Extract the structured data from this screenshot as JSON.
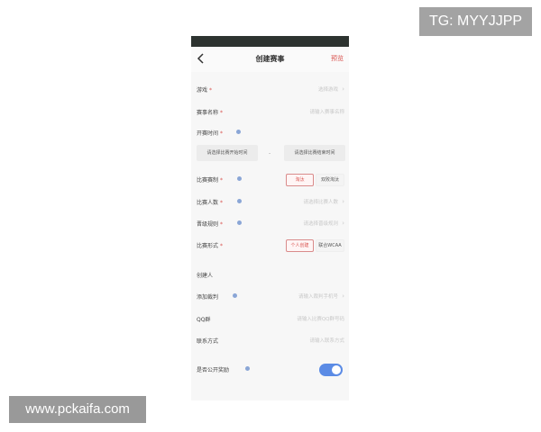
{
  "watermarks": {
    "tg": "TG: MYYJJPP",
    "site": "www.pckaifa.com"
  },
  "nav": {
    "back_icon": "chevron-left-icon",
    "title": "创建赛事",
    "preview": "预览"
  },
  "fields": {
    "game": {
      "label": "游戏",
      "required": "*",
      "placeholder": "选择游戏"
    },
    "name": {
      "label": "赛事名称",
      "required": "*",
      "placeholder": "请输入赛事名称"
    },
    "start_time": {
      "label": "开赛时间",
      "required": "*",
      "start_placeholder": "请选择比赛开始时间",
      "end_placeholder": "请选择比赛结束时间",
      "separator": "-"
    },
    "format": {
      "label": "比赛赛制",
      "required": "*",
      "options": [
        "淘汰",
        "双败淘汰"
      ],
      "selected": "淘汰"
    },
    "players": {
      "label": "比赛人数",
      "required": "*",
      "placeholder": "请选择比赛人数"
    },
    "advance": {
      "label": "晋级规则",
      "required": "*",
      "placeholder": "请选择晋级规则"
    },
    "form": {
      "label": "比赛形式",
      "required": "*",
      "options": [
        "个人创建",
        "联合WCAA"
      ],
      "selected": "个人创建"
    },
    "creator": {
      "label": "创建人"
    },
    "referee": {
      "label": "添加裁判",
      "placeholder": "请输入裁判手机号"
    },
    "qq": {
      "label": "QQ群",
      "placeholder": "请输入比赛QQ群号码"
    },
    "contact": {
      "label": "联系方式",
      "placeholder": "请输入联系方式"
    },
    "public": {
      "label": "是否公开奖励",
      "enabled": true
    }
  },
  "colors": {
    "accent": "#d9534f",
    "toggle": "#5b8be5",
    "info": "#8aa6d6",
    "statusbar": "#2d3330"
  }
}
